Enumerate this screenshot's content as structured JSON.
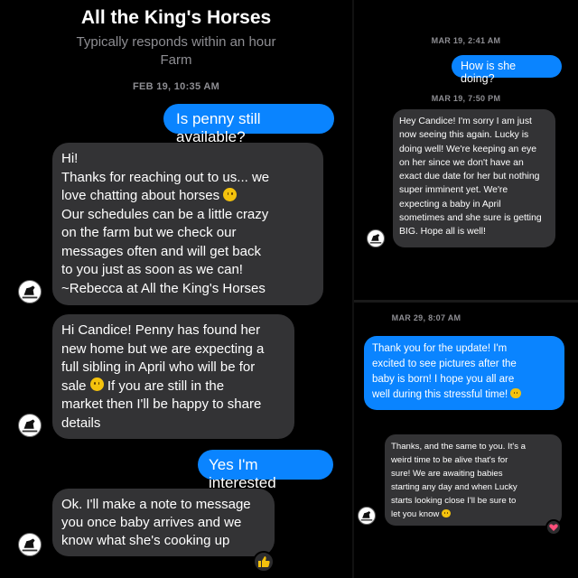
{
  "left": {
    "header": {
      "title": "All the King's Horses",
      "subtitle": "Typically responds within an hour",
      "category": "Farm"
    },
    "timestamp": "FEB 19, 10:35 AM",
    "messages": {
      "out1": "Is penny still available?",
      "in1_line1": "Hi!",
      "in1_line2": "Thanks for reaching out to us... we",
      "in1_line3": "love chatting about horses",
      "in1_line4": "Our schedules can be a little crazy",
      "in1_line5": "on the farm but we check our",
      "in1_line6": "messages often and will get back",
      "in1_line7": "to you just as soon as we can!",
      "in1_line8": "~Rebecca at All the King's Horses",
      "in2_line1": "Hi Candice! Penny has found her",
      "in2_line2": "new home but we are expecting a",
      "in2_line3": "full sibling in April who will be for",
      "in2_line4": "sale",
      "in2_line4b": "If you are still in the",
      "in2_line5": "market then I'll be happy to share",
      "in2_line6": "details",
      "out2": "Yes I'm interested",
      "in3_line1": "Ok. I'll make a note to message",
      "in3_line2": "you once baby arrives and we",
      "in3_line3": "know what she's cooking up"
    },
    "reaction_icon": "thumbs-up-icon"
  },
  "right": {
    "ts1": "MAR 19, 2:41 AM",
    "out1": "How is she doing?",
    "ts2": "MAR 19, 7:50 PM",
    "in1_lines": [
      "Hey Candice!  I'm sorry I am just",
      "now seeing this again.  Lucky is",
      "doing well!  We're keeping an eye",
      "on her since we don't have an",
      "exact due date for her but nothing",
      "super imminent yet.  We're",
      "expecting a baby in April",
      "sometimes and she sure is getting",
      "BIG.  Hope all is well!"
    ],
    "ts3": "MAR 29, 8:07 AM",
    "out2_lines": [
      "Thank you for the update! I'm",
      "excited to see pictures after the",
      "baby is born! I hope you all are",
      "well during this stressful time!"
    ],
    "in2_lines": [
      "Thanks, and the same to you. It's a",
      "weird time to be alive that's for",
      "sure! We are awaiting babies",
      "starting any day and when Lucky",
      "starts looking close I'll be sure to",
      "let you know"
    ],
    "reaction_icon": "heart-icon"
  },
  "colors": {
    "outgoing": "#0a84ff",
    "incoming": "#333335",
    "background": "#000000",
    "timestamp": "#8e8e93"
  }
}
